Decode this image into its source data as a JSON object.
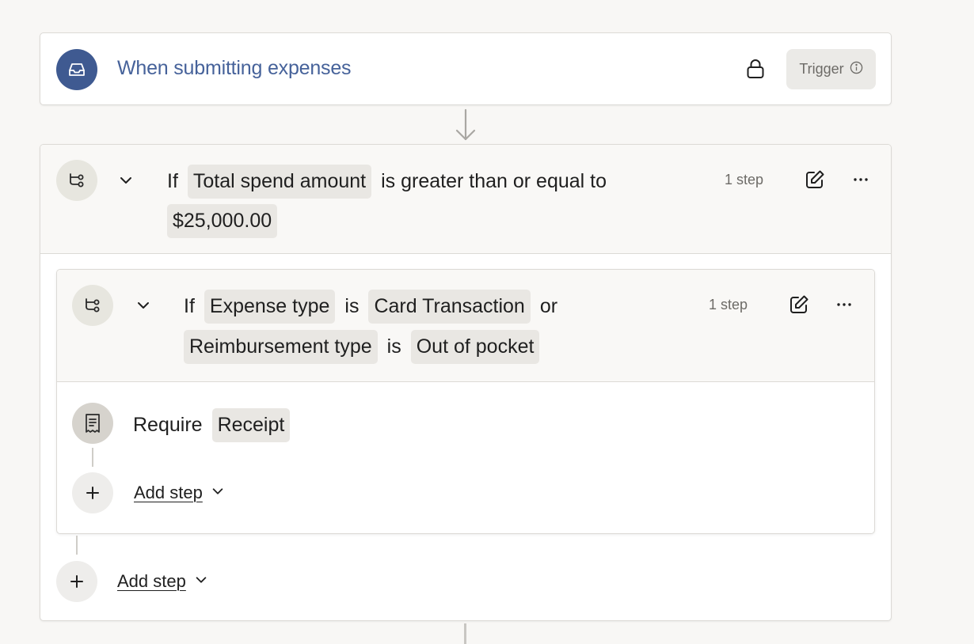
{
  "trigger": {
    "title": "When submitting expenses",
    "badge_label": "Trigger",
    "avatar_icon": "inbox-icon",
    "accent_color": "#3f5a91"
  },
  "condition": {
    "if_word": "If",
    "field_chip": "Total spend amount",
    "operator": "is greater than or equal to",
    "value_chip": "$25,000.00",
    "step_count": "1 step",
    "avatar_icon": "branch-icon"
  },
  "nested_condition": {
    "if_word": "If",
    "field1_chip": "Expense type",
    "is_word1": "is",
    "value1_chip": "Card Transaction",
    "or_word": "or",
    "field2_chip": "Reimbursement type",
    "is_word2": "is",
    "value2_chip": "Out of pocket",
    "step_count": "1 step",
    "avatar_icon": "branch-icon"
  },
  "step": {
    "action": "Require",
    "target_chip": "Receipt",
    "avatar_icon": "receipt-icon"
  },
  "add_step_inner": {
    "label": "Add step"
  },
  "add_step_outer": {
    "label": "Add step"
  }
}
